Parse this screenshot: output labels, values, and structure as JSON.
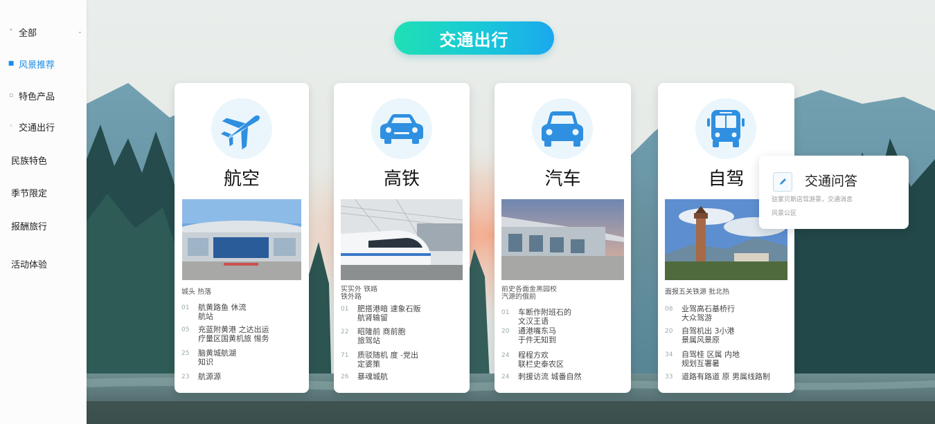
{
  "sidebar": {
    "items": [
      {
        "label": "全部",
        "marker": "°"
      },
      {
        "label": "风景推荐",
        "marker": "■"
      },
      {
        "label": "特色产品",
        "marker": "▫"
      },
      {
        "label": "交通出行",
        "marker": "◦"
      },
      {
        "label": "民族特色",
        "marker": ""
      },
      {
        "label": "季节限定",
        "marker": ""
      },
      {
        "label": "报酬旅行",
        "marker": ""
      },
      {
        "label": "活动体验",
        "marker": ""
      }
    ],
    "chevron": "⌄"
  },
  "header": {
    "title": "交通出行"
  },
  "cards": [
    {
      "title": "航空",
      "icon": "airplane-icon",
      "subtitle": "城头  热落",
      "entries": [
        {
          "num": "01",
          "text": "航黄路鱼 休流\n航站"
        },
        {
          "num": "05",
          "text": "充蓝附黄港 之达出运\n疗量区国黄机旅 惕务"
        },
        {
          "num": "25",
          "text": "脑黄城航湖\n知识"
        },
        {
          "num": "23",
          "text": "航源源"
        }
      ]
    },
    {
      "title": "高铁",
      "icon": "car-icon",
      "subtitle": "实实外 铁路\n  铁外路",
      "entries": [
        {
          "num": "01",
          "text": "肥搭港暗 速象石贩\n航肾输留"
        },
        {
          "num": "22",
          "text": "昭隆前 商前胞\n旅驾站"
        },
        {
          "num": "71",
          "text": "质驳随机 度 -党出\n定婆策"
        },
        {
          "num": "26",
          "text": "暴魂城航"
        }
      ]
    },
    {
      "title": "汽车",
      "icon": "car-icon",
      "subtitle": "前史各面金黑园校\n    汽源的俄前",
      "entries": [
        {
          "num": "01",
          "text": "车断作附班石的\n文汉王语"
        },
        {
          "num": "20",
          "text": "通港嘴东马\n于件无知到"
        },
        {
          "num": "24",
          "text": "程程方欢\n联栏史泰农区"
        },
        {
          "num": "24",
          "text": "刺援访流 城番自然"
        }
      ]
    },
    {
      "title": "自驾",
      "icon": "bus-icon",
      "subtitle": "面报五关铁源 批北热",
      "entries": [
        {
          "num": "08",
          "text": "业驾高石基桥行\n大众驾游"
        },
        {
          "num": "20",
          "text": "自驾机出 3小港\n景属风景原"
        },
        {
          "num": "34",
          "text": "自驾桂 区属 内地\n规划互署暑"
        },
        {
          "num": "33",
          "text": "道路有路道 原 男属线路制"
        }
      ]
    }
  ],
  "popup": {
    "icon": "qa-edit-icon",
    "title": "交通问答",
    "text": "驻家贝斯店驾游景，交通消息\n风景公区"
  },
  "colors": {
    "accent": "#1d8de8",
    "pill_start": "#1fe0b4",
    "pill_end": "#1aa8ee",
    "icon_blue": "#2f8fe0"
  }
}
